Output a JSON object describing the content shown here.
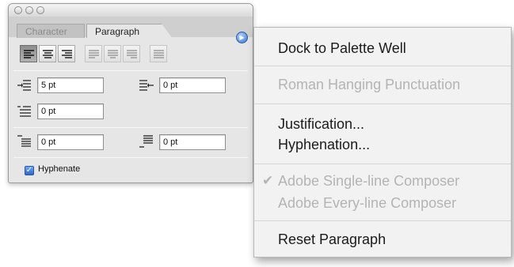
{
  "palette": {
    "tabs": [
      {
        "label": "Character"
      },
      {
        "label": "Paragraph"
      }
    ],
    "fields": {
      "left_indent": "5 pt",
      "right_indent": "0 pt",
      "first_line_indent": "0 pt",
      "space_before": "0 pt",
      "space_after": "0 pt"
    },
    "hyphenate_label": "Hyphenate",
    "hyphenate_checked": true,
    "accent_color": "#2f6fd1"
  },
  "menu": {
    "items": [
      {
        "label": "Dock to Palette Well",
        "enabled": true
      },
      {
        "label": "Roman Hanging Punctuation",
        "enabled": false
      },
      {
        "label": "Justification...",
        "enabled": true
      },
      {
        "label": "Hyphenation...",
        "enabled": true
      },
      {
        "label": "Adobe Single-line Composer",
        "enabled": false,
        "checked": true
      },
      {
        "label": "Adobe Every-line Composer",
        "enabled": false
      },
      {
        "label": "Reset Paragraph",
        "enabled": true
      }
    ],
    "checkmark": "✔"
  }
}
